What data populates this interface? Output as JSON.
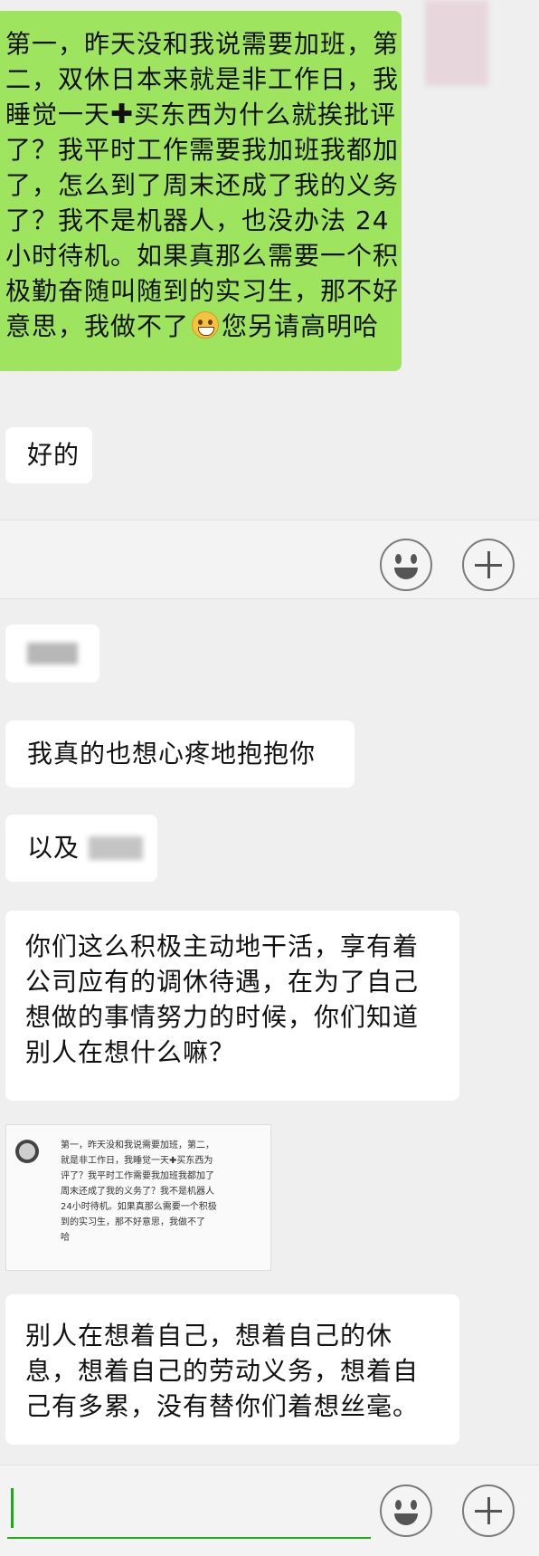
{
  "messages": {
    "m1": {
      "lines": [
        "第一，昨天没和我说需要加班，第",
        "二，双休日本来就是非工作日，我",
        "睡觉一天",
        "买东西为什么就挨批评",
        "了？我平时工作需要我加班我都加",
        "了，怎么到了周末还成了我的义务",
        "了？我不是机器人，也没办法 24",
        "小时待机。如果真那么需要一个积",
        "极勤奋随叫随到的实习生，那不好",
        "意思，我做不了",
        "您另请高明哈"
      ],
      "plus_glyph": "✚"
    },
    "m2": "好的",
    "m3": "我真的也想心疼地抱抱你",
    "m4": "以及",
    "m5": [
      "你们这么积极主动地干活，享有着",
      "公司应有的调休待遇，在为了自己",
      "想做的事情努力的时候，你们知道",
      "别人在想什么嘛？"
    ],
    "thumb": [
      "第一，昨天没和我说需要加班，第二，",
      "就是非工作日，我睡觉一天✚买东西为",
      "评了？我平时工作需要我加班我都加了",
      "周末还成了我的义务了？我不是机器人",
      "24小时待机。如果真那么需要一个积极",
      "到的实习生，那不好意思，我做不了",
      "哈"
    ],
    "m6": [
      "别人在想着自己，想着自己的休",
      "息，想着自己的劳动义务，想着自",
      "己有多累，没有替你们着想丝毫。"
    ]
  },
  "icons": {
    "emoji": "smile-face-icon",
    "add": "plus-circle-icon"
  },
  "colors": {
    "sent_bubble": "#9fe45f",
    "received_bubble": "#ffffff",
    "background": "#efefef"
  }
}
